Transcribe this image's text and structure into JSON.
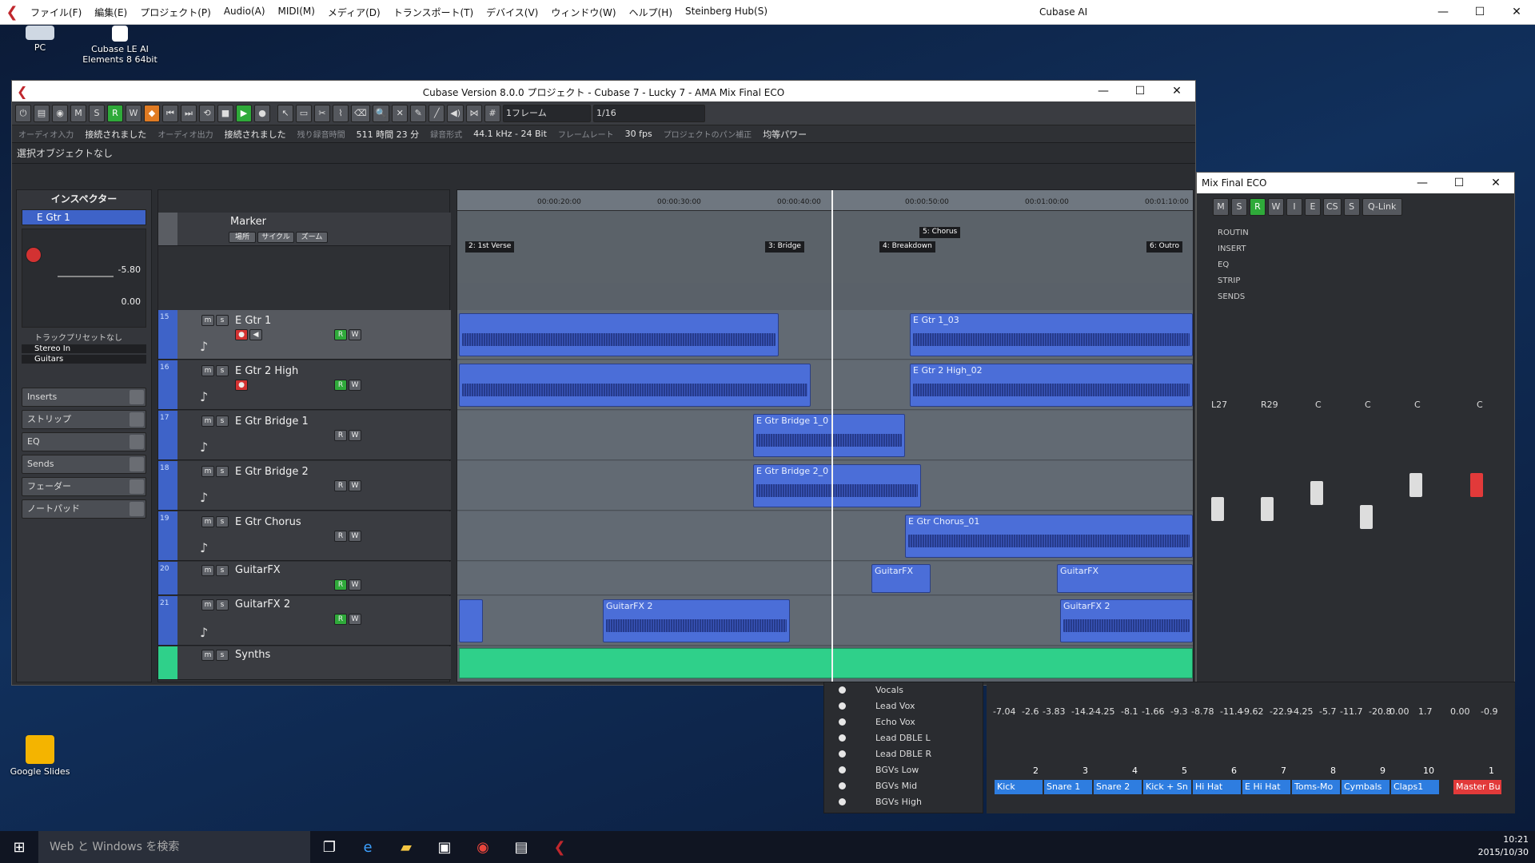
{
  "app": {
    "menus": [
      "ファイル(F)",
      "編集(E)",
      "プロジェクト(P)",
      "Audio(A)",
      "MIDI(M)",
      "メディア(D)",
      "トランスポート(T)",
      "デバイス(V)",
      "ウィンドウ(W)",
      "ヘルプ(H)",
      "Steinberg Hub(S)"
    ],
    "title": "Cubase AI"
  },
  "desktop": {
    "icons": [
      {
        "label": "PC"
      },
      {
        "label": "Cubase LE AI Elements 8 64bit"
      },
      {
        "label": "Google Slides"
      }
    ]
  },
  "project_window": {
    "title": "Cubase Version 8.0.0 プロジェクト - Cubase 7 - Lucky 7 - AMA Mix Final ECO",
    "toolbar": {
      "mode_buttons": [
        "M",
        "S",
        "R",
        "W"
      ],
      "frame_rate_select": "1フレーム",
      "quantize": "1/16"
    },
    "status": {
      "audio_in_label": "オーディオ入力",
      "audio_in_value": "接続されました",
      "audio_out_label": "オーディオ出力",
      "audio_out_value": "接続されました",
      "rec_time_label": "残り録音時間",
      "rec_time_value": "511 時間 23 分",
      "rec_format_label": "録音形式",
      "rec_format_value": "44.1 kHz - 24 Bit",
      "frame_rate_label": "フレームレート",
      "frame_rate_value": "30 fps",
      "pan_label": "プロジェクトのパン補正",
      "pan_value": "均等パワー"
    },
    "info_line": "選択オブジェクトなし",
    "inspector": {
      "heading": "インスペクター",
      "track_name": "E Gtr 1",
      "volume": "-5.80",
      "pan": "0.00",
      "preset": "トラックプリセットなし",
      "input": "Stereo In",
      "output": "Guitars",
      "sections": [
        "Inserts",
        "ストリップ",
        "EQ",
        "Sends",
        "フェーダー",
        "ノートパッド"
      ]
    },
    "marker_track": {
      "name": "Marker",
      "buttons": [
        "場所",
        "サイクル",
        "ズーム"
      ]
    },
    "tracks": [
      {
        "num": "15",
        "name": "E Gtr 1"
      },
      {
        "num": "16",
        "name": "E Gtr 2 High"
      },
      {
        "num": "17",
        "name": "E Gtr Bridge 1"
      },
      {
        "num": "18",
        "name": "E Gtr Bridge 2"
      },
      {
        "num": "19",
        "name": "E Gtr Chorus"
      },
      {
        "num": "20",
        "name": "GuitarFX"
      },
      {
        "num": "21",
        "name": "GuitarFX 2"
      },
      {
        "num": "",
        "name": "Synths"
      }
    ],
    "ruler": [
      "00:00:20:00",
      "00:00:30:00",
      "00:00:40:00",
      "00:00:50:00",
      "00:01:00:00",
      "00:01:10:00"
    ],
    "markers": [
      "2: 1st Verse",
      "3: Bridge",
      "4: Breakdown",
      "5: Chorus",
      "6: Outro"
    ],
    "clips": [
      "E Gtr 1_03",
      "E Gtr 2 High_02",
      "E Gtr Bridge 1_0",
      "E Gtr Bridge 2_0",
      "E Gtr Chorus_01",
      "GuitarFX",
      "GuitarFX",
      "GuitarFX 2",
      "GuitarFX 2"
    ]
  },
  "mixer_window": {
    "title": "Mix Final ECO",
    "top_buttons": [
      "M",
      "S",
      "R",
      "W",
      "I",
      "E",
      "CS",
      "S",
      "Q-Link"
    ],
    "rows": [
      "ROUTIN",
      "INSERT",
      "EQ",
      "STRIP",
      "SENDS"
    ],
    "pans": [
      "L27",
      "R29",
      "C",
      "C",
      "C",
      "C"
    ],
    "readouts": [
      "-7.04",
      "-2.6",
      "-3.83",
      "-14.2",
      "-4.25",
      "-8.1",
      "-1.66",
      "-9.3",
      "-8.78",
      "-11.4",
      "-9.62",
      "-22.9",
      "-4.25",
      "-5.7",
      "-11.7",
      "-20.8",
      "0.00",
      "1.7",
      "0.00",
      "-0.9"
    ],
    "channels": [
      {
        "num": "2",
        "name": "Kick"
      },
      {
        "num": "3",
        "name": "Snare 1"
      },
      {
        "num": "4",
        "name": "Snare 2"
      },
      {
        "num": "5",
        "name": "Kick + Sn"
      },
      {
        "num": "6",
        "name": "Hi Hat"
      },
      {
        "num": "7",
        "name": "E Hi Hat"
      },
      {
        "num": "8",
        "name": "Toms-Mo"
      },
      {
        "num": "9",
        "name": "Cymbals"
      },
      {
        "num": "10",
        "name": "Claps1"
      },
      {
        "num": "1",
        "name": "Master Bu"
      }
    ],
    "visibility": [
      "Vocals",
      "Lead Vox",
      "Echo Vox",
      "Lead DBLE L",
      "Lead DBLE R",
      "BGVs Low",
      "BGVs Mid",
      "BGVs High"
    ]
  },
  "taskbar": {
    "search": "Web と Windows を検索",
    "time": "10:21",
    "date": "2015/10/30"
  }
}
